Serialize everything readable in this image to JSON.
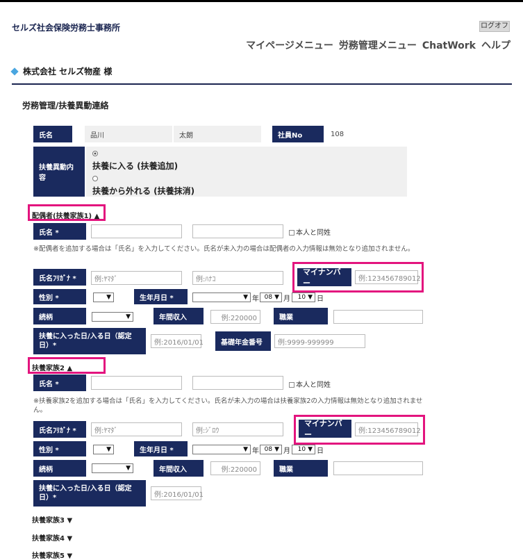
{
  "header": {
    "site_title": "セルズ社会保険労務士事務所",
    "logout": "ログオフ",
    "nav": [
      "マイページメニュー",
      "労務管理メニュー",
      "ChatWork",
      "ヘルプ"
    ]
  },
  "company": "株式会社 セルズ物産 様",
  "page_title": "労務管理/扶養異動連絡",
  "employee": {
    "name_label": "氏名",
    "last_name": "品川",
    "first_name": "太朗",
    "no_label": "社員No",
    "no_value": "108"
  },
  "change": {
    "label": "扶養異動内容",
    "options": [
      "扶養に入る (扶養追加)",
      "扶養から外れる (扶養抹消)"
    ]
  },
  "common": {
    "name_label": "氏名 *",
    "same_surname": "本人と同姓",
    "kana_label": "氏名ﾌﾘｶﾞﾅ *",
    "mynumber_label": "マイナンバー",
    "mynumber_ph": "例:123456789012",
    "sex_label": "性別 *",
    "birth_label": "生年月日 *",
    "year_unit": "年",
    "month_unit": "月",
    "day_unit": "日",
    "month_value": "08",
    "day_value": "10",
    "relation_label": "続柄",
    "income_label": "年間収入",
    "income_ph": "例:220000",
    "job_label": "職業",
    "date_label": "扶養に入った日/入る日（認定日）*",
    "date_ph": "例:2016/01/01",
    "pension_label": "基礎年金番号",
    "pension_ph": "例:9999-999999"
  },
  "spouse": {
    "title": "配偶者(扶養家族1) ▲",
    "note": "※配偶者を追加する場合は「氏名」を入力してください。氏名が未入力の場合は配偶者の入力情報は無効となり追加されません。",
    "kana_last_ph": "例:ﾔﾏﾀﾞ",
    "kana_first_ph": "例:ﾊﾅｺ"
  },
  "dep2": {
    "title": "扶養家族2 ▲",
    "note": "※扶養家族2を追加する場合は「氏名」を入力してください。氏名が未入力の場合は扶養家族2の入力情報は無効となり追加されません。",
    "kana_last_ph": "例:ﾔﾏﾀﾞ",
    "kana_first_ph": "例:ｼﾞﾛｳ"
  },
  "collapsed": [
    "扶養家族3 ▼",
    "扶養家族4 ▼",
    "扶養家族5 ▼"
  ]
}
